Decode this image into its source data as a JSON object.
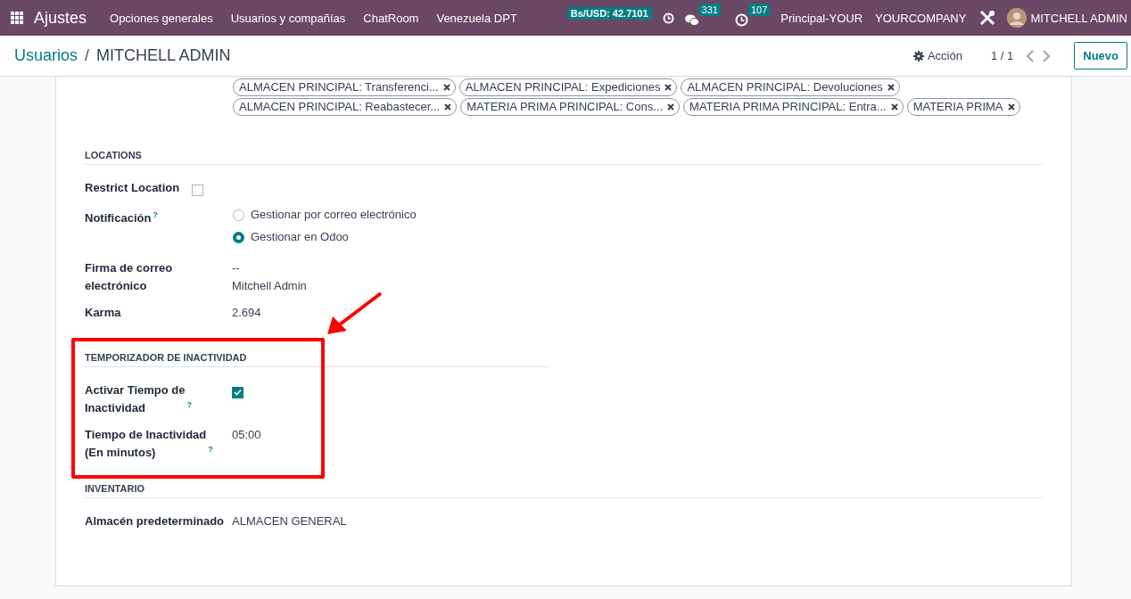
{
  "navbar": {
    "app_name": "Ajustes",
    "menus": [
      "Opciones generales",
      "Usuarios y compañías",
      "ChatRoom",
      "Venezuela DPT"
    ],
    "rate_badge": "Bs/USD: 42.7101",
    "messages_count": "331",
    "activities_count": "107",
    "branch": "Principal-YOUR",
    "company": "YOURCOMPANY",
    "user_name": "MITCHELL ADMIN"
  },
  "control_panel": {
    "breadcrumb_parent": "Usuarios",
    "breadcrumb_separator": "/",
    "breadcrumb_current": "MITCHELL ADMIN",
    "action_label": "Acción",
    "pager": "1 / 1",
    "new_button": "Nuevo"
  },
  "tag_rows": [
    [
      "ALMACEN PRINCIPAL: Transferenci...",
      "ALMACEN PRINCIPAL: Expediciones",
      "ALMACEN PRINCIPAL: Devoluciones"
    ],
    [
      "ALMACEN PRINCIPAL: Reabastecer...",
      "MATERIA PRIMA PRINCIPAL: Cons...",
      "MATERIA PRIMA PRINCIPAL: Entra...",
      "MATERIA PRIMA"
    ]
  ],
  "sections": [
    {
      "kind": "full",
      "title": "LOCATIONS",
      "highlighted": false,
      "fields": [
        {
          "kind": "checkbox",
          "label": "Restrict Location",
          "checked": false
        },
        {
          "kind": "radio",
          "label": "Notificación",
          "help": "?",
          "options": [
            {
              "label": "Gestionar por correo electrónico",
              "selected": false
            },
            {
              "label": "Gestionar en Odoo",
              "selected": true
            }
          ]
        },
        {
          "kind": "text",
          "label": "Firma de correo\nelectrónico",
          "lines": [
            "--",
            "Mitchell Admin"
          ]
        },
        {
          "kind": "text",
          "label": "Karma",
          "lines": [
            "2.694"
          ]
        }
      ]
    },
    {
      "kind": "half",
      "title": "TEMPORIZADOR DE INACTIVIDAD",
      "highlighted": true,
      "fields": [
        {
          "kind": "checkbox",
          "label": "Activar Tiempo de\nInactividad",
          "help": "?",
          "checked": true
        },
        {
          "kind": "text",
          "label": "Tiempo de Inactividad\n(En minutos)",
          "help": "?",
          "lines": [
            "05:00"
          ]
        }
      ]
    },
    {
      "kind": "full",
      "title": "INVENTARIO",
      "highlighted": false,
      "fields": [
        {
          "kind": "text",
          "label": "Almacén predeterminado",
          "lines": [
            "ALMACEN GENERAL"
          ]
        }
      ]
    }
  ]
}
